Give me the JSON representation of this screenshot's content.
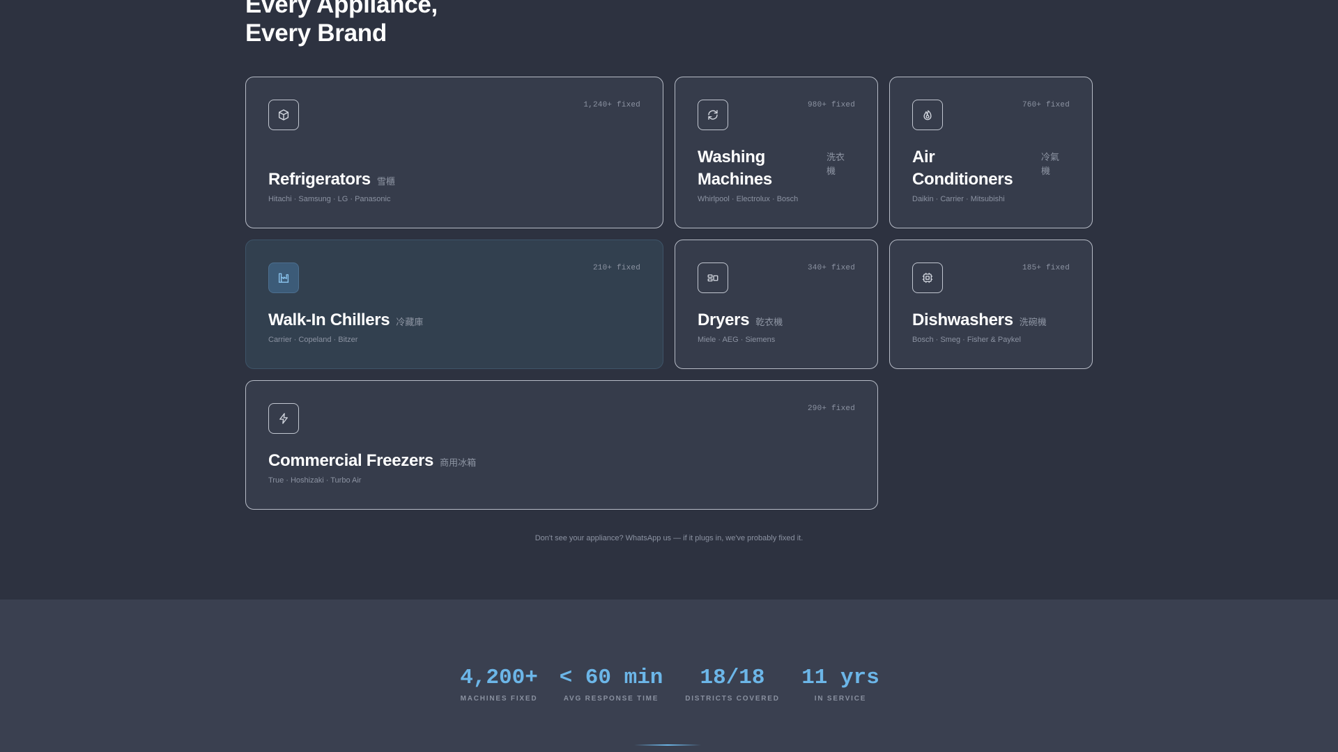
{
  "heading": {
    "line1": "Every Appliance,",
    "line2": "Every Brand"
  },
  "cards": [
    {
      "title": "Refrigerators",
      "zh": "雪櫃",
      "count": "1,240+ fixed",
      "brands": "Hitachi · Samsung · LG · Panasonic",
      "icon": "box-icon"
    },
    {
      "title": "Washing Machines",
      "zh": "洗衣機",
      "count": "980+ fixed",
      "brands": "Whirlpool · Electrolux · Bosch",
      "icon": "refresh-icon"
    },
    {
      "title": "Air Conditioners",
      "zh": "冷氣機",
      "count": "760+ fixed",
      "brands": "Daikin · Carrier · Mitsubishi",
      "icon": "flame-icon"
    },
    {
      "title": "Walk-In Chillers",
      "zh": "冷藏庫",
      "count": "210+ fixed",
      "brands": "Carrier · Copeland · Bitzer",
      "icon": "factory-icon"
    },
    {
      "title": "Dryers",
      "zh": "乾衣機",
      "count": "340+ fixed",
      "brands": "Miele · AEG · Siemens",
      "icon": "dryer-icon"
    },
    {
      "title": "Dishwashers",
      "zh": "洗碗機",
      "count": "185+ fixed",
      "brands": "Bosch · Smeg · Fisher & Paykel",
      "icon": "chip-icon"
    },
    {
      "title": "Commercial Freezers",
      "zh": "商用冰箱",
      "count": "290+ fixed",
      "brands": "True · Hoshizaki · Turbo Air",
      "icon": "bolt-icon"
    }
  ],
  "note": "Don't see your appliance? WhatsApp us — if it plugs in, we've probably fixed it.",
  "stats": [
    {
      "value": "4,200+",
      "label": "MACHINES FIXED"
    },
    {
      "value": "< 60 min",
      "label": "AVG RESPONSE TIME"
    },
    {
      "value": "18/18",
      "label": "DISTRICTS COVERED"
    },
    {
      "value": "11 yrs",
      "label": "IN SERVICE"
    }
  ],
  "colors": {
    "background": "#2d3240",
    "card": "#363c4b",
    "accent": "#6cb6e8",
    "muted": "#8c93a2"
  }
}
